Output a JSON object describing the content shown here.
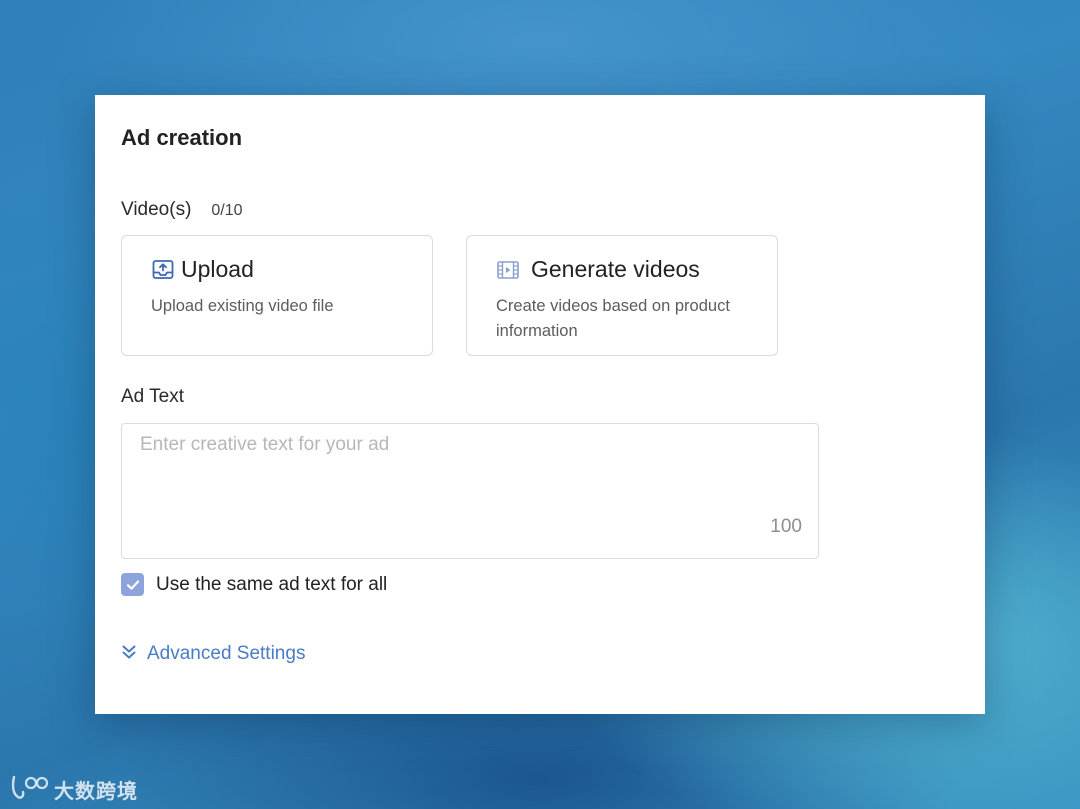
{
  "dialog": {
    "title": "Ad creation"
  },
  "videos": {
    "label": "Video(s)",
    "count": "0/10",
    "options": [
      {
        "icon": "upload-tray-icon",
        "label": "Upload",
        "description": "Upload existing video file"
      },
      {
        "icon": "film-icon",
        "label": "Generate videos",
        "description": "Create videos based on product information"
      }
    ]
  },
  "ad_text": {
    "label": "Ad Text",
    "placeholder": "Enter creative text for your ad",
    "value": "",
    "char_limit": "100"
  },
  "same_text_checkbox": {
    "label": "Use the same ad text for all",
    "checked": true
  },
  "advanced": {
    "label": "Advanced Settings",
    "icon": "double-chevron-down-icon"
  },
  "watermark": {
    "text": "大数跨境"
  },
  "colors": {
    "accent": "#4a7bc4",
    "checkbox": "#8ca3dc",
    "upload_icon": "#3d6ab3",
    "film_icon": "#8aa0cc"
  }
}
